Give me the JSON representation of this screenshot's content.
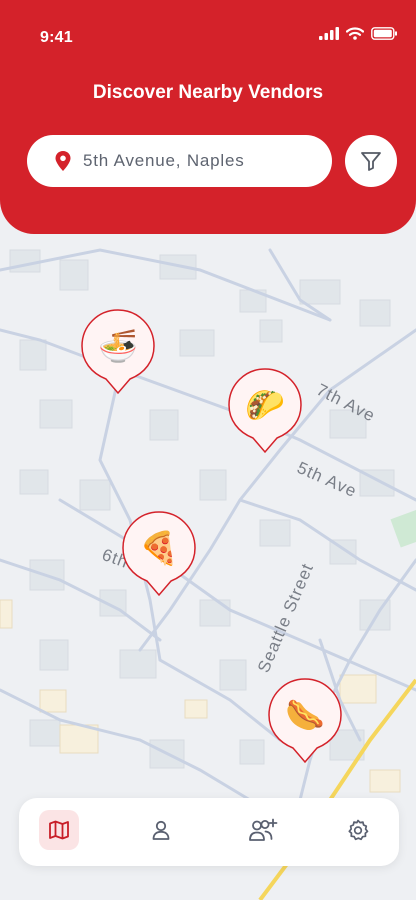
{
  "status": {
    "time": "9:41"
  },
  "header": {
    "title": "Discover Nearby Vendors",
    "search_value": "5th Avenue, Naples"
  },
  "map": {
    "streets": {
      "seventh": "7th Ave",
      "fifth": "5th Ave",
      "sixth": "6th",
      "seattle": "Seattle Street"
    }
  },
  "vendors": [
    {
      "name": "noodles-vendor",
      "icon": "🍜"
    },
    {
      "name": "taco-vendor",
      "icon": "🌮"
    },
    {
      "name": "pizza-vendor",
      "icon": "🍕"
    },
    {
      "name": "hotdog-vendor",
      "icon": "🌭"
    }
  ],
  "nav": {
    "items": [
      "map-icon",
      "user-icon",
      "add-friends-icon",
      "settings-icon"
    ],
    "active": "map-icon"
  },
  "colors": {
    "brand": "#d4222a",
    "accent_bg": "#fbe4e5",
    "map_bg": "#eef0f3",
    "road": "#c9d2e3"
  }
}
